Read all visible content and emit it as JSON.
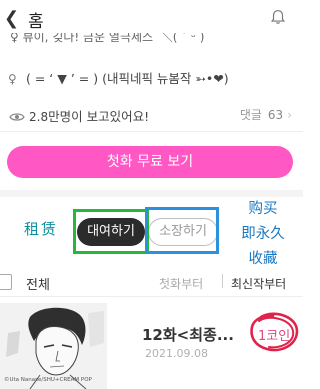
{
  "header": {
    "back_icon": "chevron-left-icon",
    "title": "홈",
    "bell_icon": "bell-icon"
  },
  "info": {
    "line1_text": "♀ 뷰이, 깆다! 금운 열극세스 ̄ ＼( ˊ ᵕ )",
    "tags_icon": "tag-icon",
    "tags_text": "(  =  ‘  ▼  ’  =  ) (내픽네픽 뉴봄작 ➳•❤︎)",
    "views_icon": "eye-icon",
    "views_number": "2.8",
    "views_text": "만명이 보고있어요!",
    "comments_label": "댓글",
    "comments_count": "63",
    "comments_arrow": "›"
  },
  "cta": {
    "label": "첫화 무료 보기",
    "color": "#ff57c4"
  },
  "purchase": {
    "rent_label": "대여하기",
    "own_label": "소장하기",
    "note_left": "租赁",
    "note_right": [
      "购买",
      "即永久",
      "收藏"
    ]
  },
  "list": {
    "all_label": "전체",
    "sort_first": "첫화부터",
    "sort_latest": "최신작부터",
    "episodes": [
      {
        "thumb_credit": "©Uta Nanase/SHU+CREAM POP",
        "title": "12화<최종...",
        "date": "2021.09.08",
        "price": "1코인"
      }
    ]
  },
  "colors": {
    "accent_pink": "#ff57c4",
    "annotation_green": "#25b93b",
    "annotation_blue": "#2b91de",
    "annotation_red": "#e0234a"
  }
}
